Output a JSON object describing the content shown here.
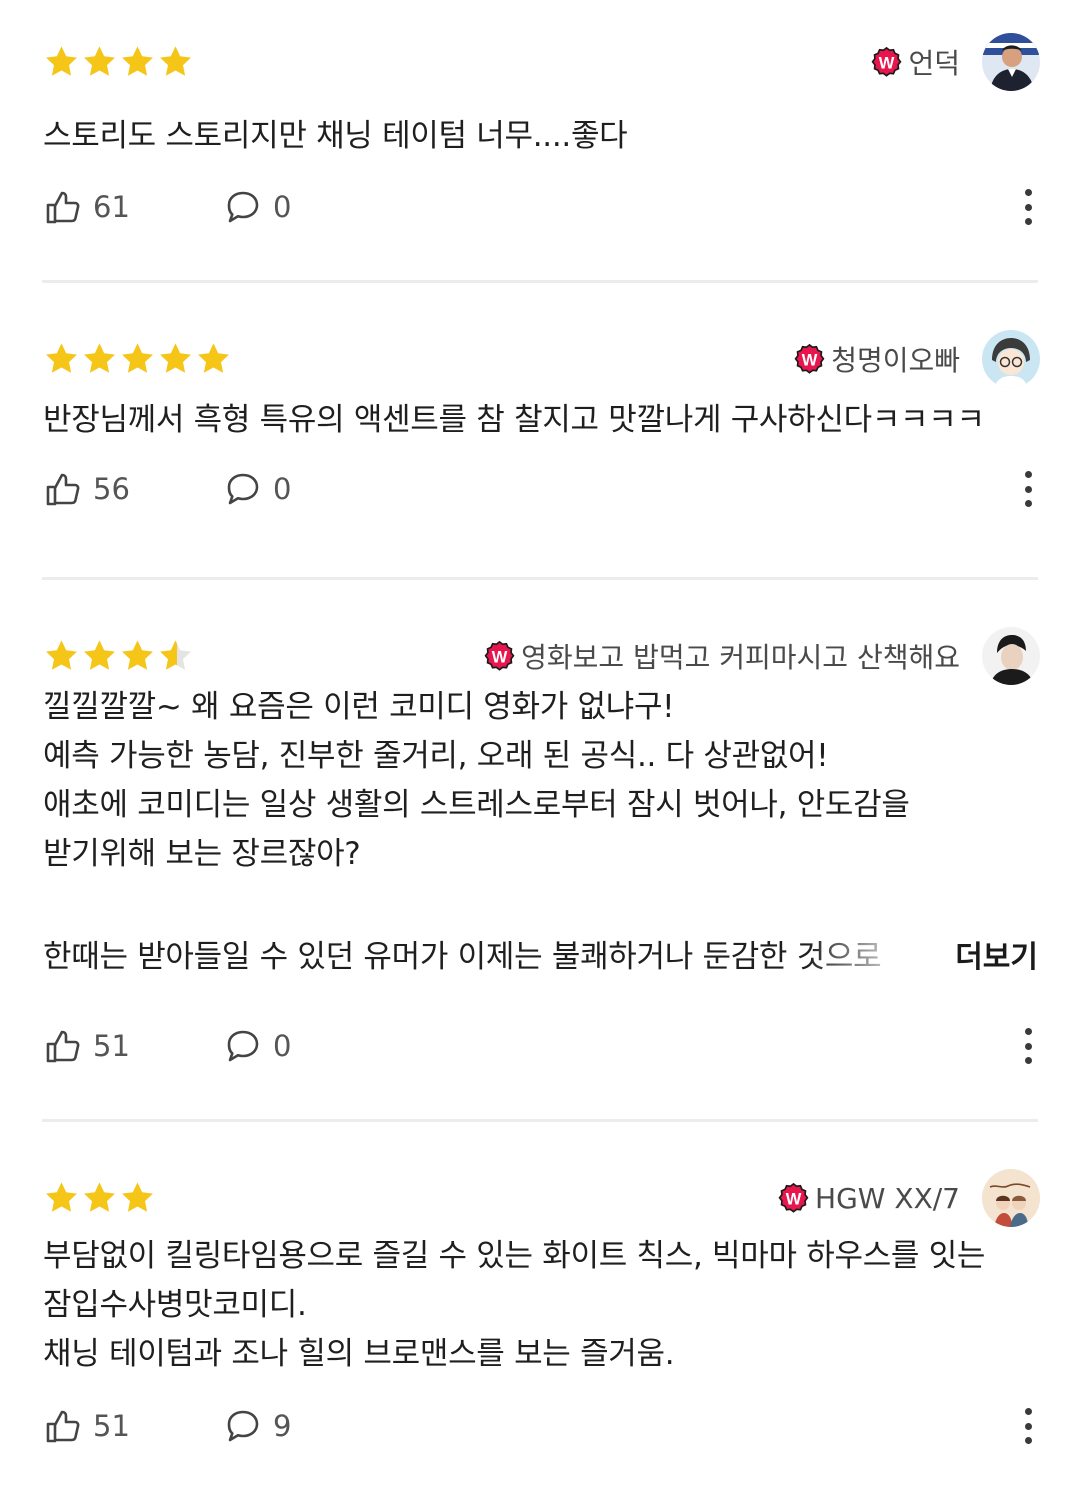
{
  "reviews": [
    {
      "rating": 4,
      "author": "언덕",
      "avatar": "avatar-man-flag",
      "text": "스토리도 스토리지만 채닝 테이텀 너무....좋다",
      "likes": "61",
      "comments": "0"
    },
    {
      "rating": 5,
      "author": "청명이오빠",
      "avatar": "avatar-cartoon-glasses",
      "text": "반장님께서 흑형 특유의 액센트를 참 찰지고 맛깔나게 구사하신다ㅋㅋㅋㅋ",
      "likes": "56",
      "comments": "0"
    },
    {
      "rating": 3.5,
      "author": "영화보고 밥먹고 커피마시고 산책해요",
      "avatar": "avatar-man-portrait",
      "text": "낄낄깔깔~ 왜 요즘은 이런 코미디 영화가 없냐구!\n예측 가능한 농담, 진부한 줄거리, 오래 된 공식.. 다 상관없어!\n애초에 코미디는 일상 생활의 스트레스로부터 잠시 벗어나, 안도감을\n받기위해 보는 장르잖아?",
      "truncated_line": "한때는 받아들일 수 있던 유머가 이제는 불쾌하거나 둔감한 것으로",
      "more_label": "더보기",
      "likes": "51",
      "comments": "0"
    },
    {
      "rating": 3,
      "author": "HGW XX/7",
      "avatar": "avatar-illustration-couple",
      "text": "부담없이 킬링타임용으로 즐길 수 있는 화이트 칙스, 빅마마 하우스를 잇는\n잠입수사병맛코미디.\n채닝 테이텀과 조나 힐의 브로맨스를 보는 즐거움.",
      "likes": "51",
      "comments": "9"
    }
  ],
  "icons": {
    "star": "star-icon",
    "like": "thumbs-up-icon",
    "comment": "speech-bubble-icon",
    "menu": "more-vertical-icon",
    "badge": "watcha-w-badge-icon"
  },
  "colors": {
    "star": "#f5c518",
    "star_empty": "#e4e4e4",
    "badge": "#e8164f",
    "divider": "#ececec",
    "text": "#1f1f1f",
    "muted": "#555555"
  }
}
